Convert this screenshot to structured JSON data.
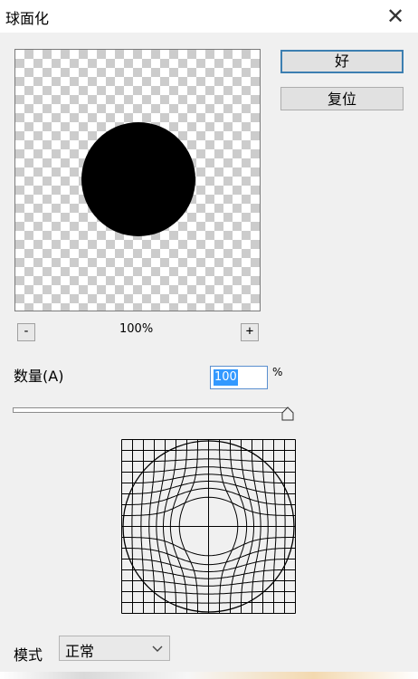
{
  "window": {
    "title": "球面化",
    "close_glyph": "✕"
  },
  "buttons": {
    "ok": "好",
    "reset": "复位"
  },
  "preview": {
    "zoom": "100%",
    "zoom_out": "-",
    "zoom_in": "+"
  },
  "amount": {
    "label": "数量(A)",
    "value": "100",
    "unit": "%",
    "level": 1.0
  },
  "mode": {
    "label": "模式",
    "selected": "正常"
  },
  "icons": {
    "close": "close-icon",
    "dropdown": "chevron-down-icon",
    "slider": "slider-thumb-icon"
  },
  "colors": {
    "accent": "#3c7fb1",
    "selection": "#3399ff",
    "sphere": "#000000"
  }
}
